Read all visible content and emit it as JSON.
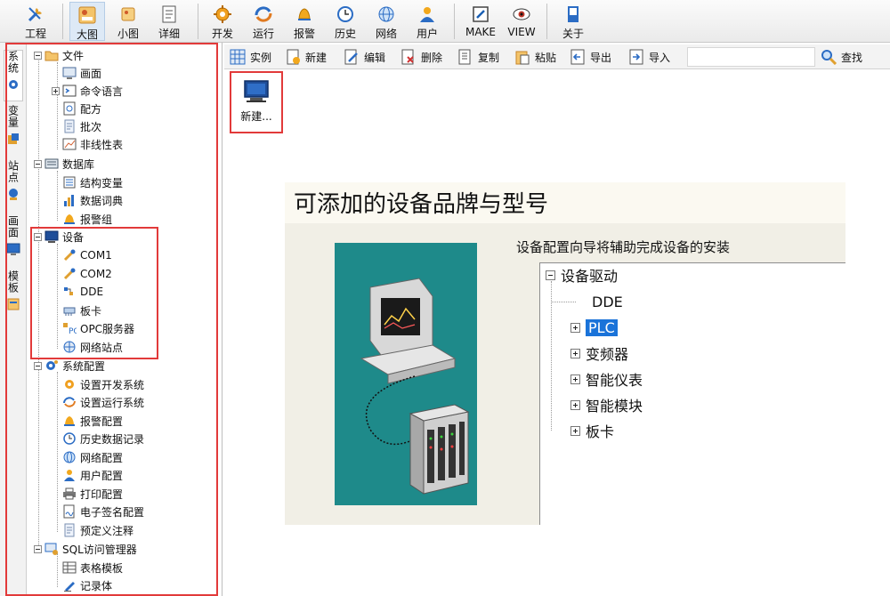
{
  "toolbar": {
    "items": [
      {
        "label": "工程",
        "icon": "wrench-icon"
      },
      {
        "label": "大图",
        "icon": "large-icons-icon"
      },
      {
        "label": "小图",
        "icon": "small-icons-icon"
      },
      {
        "label": "详细",
        "icon": "details-icon"
      },
      {
        "label": "开发",
        "icon": "gear-icon"
      },
      {
        "label": "运行",
        "icon": "run-icon"
      },
      {
        "label": "报警",
        "icon": "bell-icon"
      },
      {
        "label": "历史",
        "icon": "clock-icon"
      },
      {
        "label": "网络",
        "icon": "globe-icon"
      },
      {
        "label": "用户",
        "icon": "user-icon"
      },
      {
        "label": "MAKE",
        "icon": "edit-icon"
      },
      {
        "label": "VIEW",
        "icon": "eye-icon"
      },
      {
        "label": "关于",
        "icon": "book-icon"
      }
    ]
  },
  "vtabs": [
    {
      "label": "系统"
    },
    {
      "label": "变量"
    },
    {
      "label": "站点"
    },
    {
      "label": "画面"
    },
    {
      "label": "模板"
    }
  ],
  "tree": {
    "file": {
      "label": "文件",
      "children": [
        "画面",
        "命令语言",
        "配方",
        "批次",
        "非线性表"
      ]
    },
    "db": {
      "label": "数据库",
      "children": [
        "结构变量",
        "数据词典",
        "报警组"
      ]
    },
    "device": {
      "label": "设备",
      "children": [
        "COM1",
        "COM2",
        "DDE",
        "板卡",
        "OPC服务器",
        "网络站点"
      ]
    },
    "syscfg": {
      "label": "系统配置",
      "children": [
        "设置开发系统",
        "设置运行系统",
        "报警配置",
        "历史数据记录",
        "网络配置",
        "用户配置",
        "打印配置",
        "电子签名配置",
        "预定义注释"
      ]
    },
    "sql": {
      "label": "SQL访问管理器",
      "children": [
        "表格模板",
        "记录体"
      ]
    }
  },
  "subbar": {
    "items": [
      "实例",
      "新建",
      "编辑",
      "删除",
      "复制",
      "粘贴",
      "导出",
      "导入"
    ],
    "search_label": "查找"
  },
  "new_card": {
    "label": "新建..."
  },
  "wizard": {
    "title": "可添加的设备品牌与型号",
    "description": "设备配置向导将辅助完成设备的安装",
    "root": "设备驱动",
    "nodes": [
      "DDE",
      "PLC",
      "变频器",
      "智能仪表",
      "智能模块",
      "板卡"
    ]
  }
}
